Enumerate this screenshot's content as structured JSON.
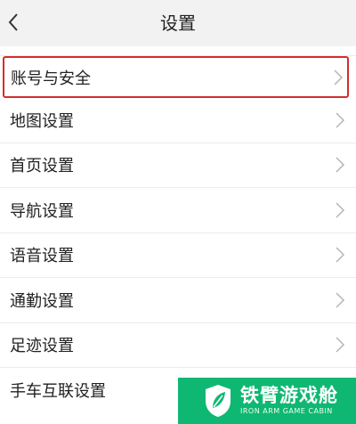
{
  "header": {
    "title": "设置",
    "back_icon": "chevron-left-icon"
  },
  "settings": {
    "items": [
      {
        "label": "账号与安全",
        "highlighted": true
      },
      {
        "label": "地图设置"
      },
      {
        "label": "首页设置"
      },
      {
        "label": "导航设置"
      },
      {
        "label": "语音设置"
      },
      {
        "label": "通勤设置"
      },
      {
        "label": "足迹设置"
      },
      {
        "label": "手车互联设置"
      }
    ]
  },
  "watermark": {
    "name_cn": "铁臂游戏舱",
    "name_en": "IRON ARM GAME CABIN",
    "color": "#0fb872"
  },
  "colors": {
    "highlight_border": "#d62c2c",
    "divider": "#ececec",
    "header_bg": "#f2f2f2"
  }
}
